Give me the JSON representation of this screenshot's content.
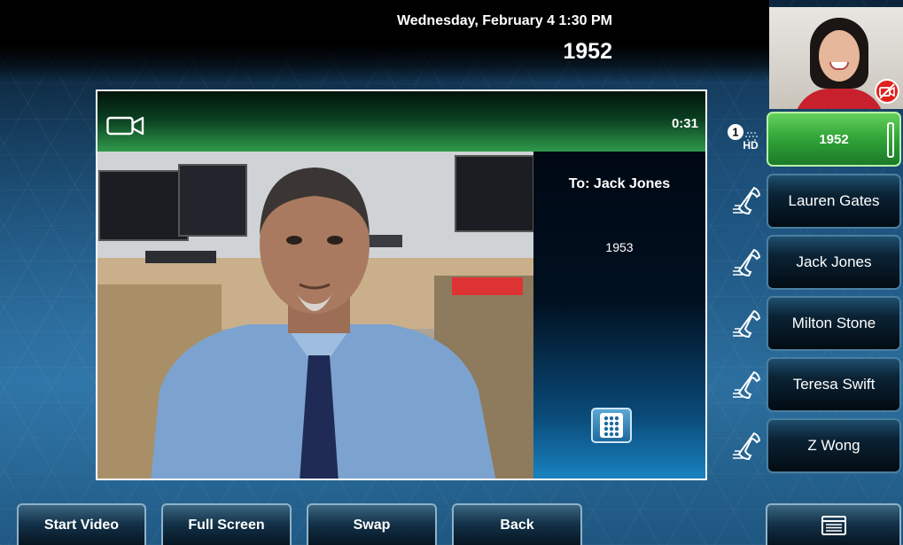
{
  "status_bar": {
    "datetime": "Wednesday, February 4  1:30 PM",
    "line_number": "1952"
  },
  "active_call": {
    "timer": "0:31",
    "to_label": "To: Jack Jones",
    "number": "1953"
  },
  "line_keys": [
    {
      "label": "1952",
      "active": true
    },
    {
      "label": "Lauren Gates",
      "active": false
    },
    {
      "label": "Jack Jones",
      "active": false
    },
    {
      "label": "Milton Stone",
      "active": false
    },
    {
      "label": "Teresa Swift",
      "active": false
    },
    {
      "label": "Z Wong",
      "active": false
    }
  ],
  "line_badge": {
    "count": "1",
    "hd_label": "HD"
  },
  "softkeys": {
    "start_video": "Start Video",
    "full_screen": "Full Screen",
    "swap": "Swap",
    "back": "Back",
    "menu_icon": "menu-list-icon"
  },
  "colors": {
    "active_line": "#3fb24a",
    "call_header": "#2f9a4a",
    "background": "#1a4a70"
  }
}
